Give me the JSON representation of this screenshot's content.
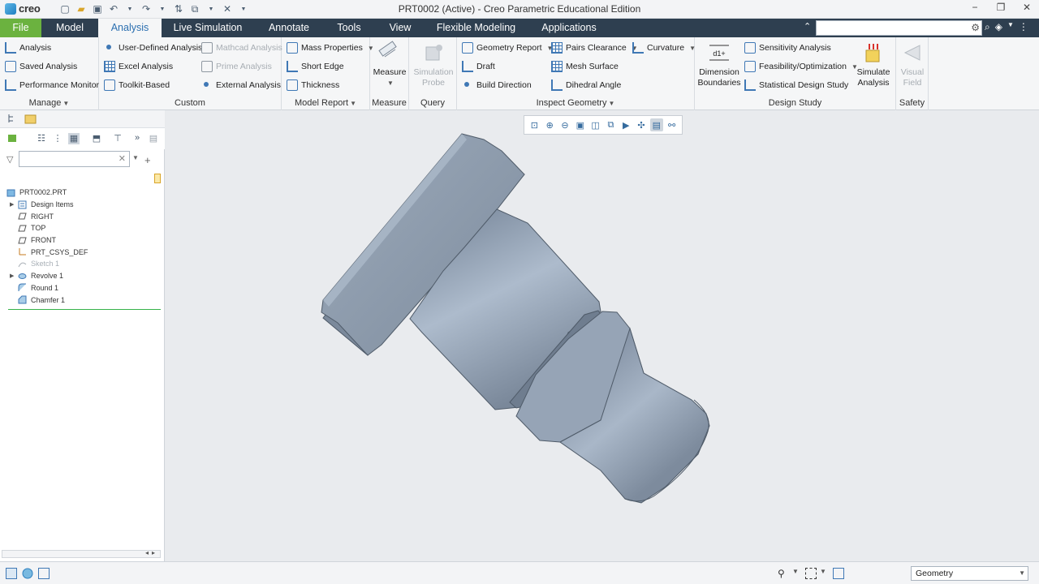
{
  "app": {
    "logo_text": "creo",
    "window_title": "PRT0002 (Active) - Creo Parametric Educational Edition"
  },
  "tabs": [
    {
      "label": "File"
    },
    {
      "label": "Model"
    },
    {
      "label": "Analysis"
    },
    {
      "label": "Live Simulation"
    },
    {
      "label": "Annotate"
    },
    {
      "label": "Tools"
    },
    {
      "label": "View"
    },
    {
      "label": "Flexible Modeling"
    },
    {
      "label": "Applications"
    }
  ],
  "search": {
    "placeholder": ""
  },
  "ribbon": {
    "manage": {
      "label": "Manage",
      "items": [
        "Analysis",
        "Saved Analysis",
        "Performance Monitor"
      ]
    },
    "custom": {
      "label": "Custom",
      "col1": [
        "User-Defined Analysis",
        "Excel Analysis",
        "Toolkit-Based"
      ],
      "col2": [
        "Mathcad Analysis",
        "Prime Analysis",
        "External Analysis"
      ]
    },
    "model_report": {
      "label": "Model Report",
      "items": [
        "Mass Properties",
        "Short Edge",
        "Thickness"
      ]
    },
    "measure": {
      "label": "Measure",
      "button": "Measure"
    },
    "query": {
      "label": "Query",
      "button_line1": "Simulation",
      "button_line2": "Probe"
    },
    "inspect": {
      "label": "Inspect Geometry",
      "col1": [
        "Geometry Report",
        "Draft",
        "Build Direction"
      ],
      "col2": [
        "Pairs Clearance",
        "Mesh Surface",
        "Dihedral Angle"
      ],
      "col3": [
        "Curvature"
      ]
    },
    "design_study": {
      "label": "Design Study",
      "dim_line1": "Dimension",
      "dim_line2": "Boundaries",
      "items": [
        "Sensitivity Analysis",
        "Feasibility/Optimization",
        "Statistical Design Study"
      ],
      "sim_line1": "Simulate",
      "sim_line2": "Analysis"
    },
    "safety": {
      "label": "Safety",
      "vf_line1": "Visual",
      "vf_line2": "Field"
    }
  },
  "model_tree": {
    "filter_value": "",
    "items": [
      {
        "label": "PRT0002.PRT",
        "dim": false
      },
      {
        "label": "Design Items",
        "dim": false
      },
      {
        "label": "RIGHT",
        "dim": false
      },
      {
        "label": "TOP",
        "dim": false
      },
      {
        "label": "FRONT",
        "dim": false
      },
      {
        "label": "PRT_CSYS_DEF",
        "dim": false
      },
      {
        "label": "Sketch 1",
        "dim": true
      },
      {
        "label": "Revolve 1",
        "dim": false
      },
      {
        "label": "Round 1",
        "dim": false
      },
      {
        "label": "Chamfer 1",
        "dim": false
      }
    ]
  },
  "statusbar": {
    "filter_value": "Geometry"
  },
  "colors": {
    "tabbar": "#2e3f50",
    "file_tab": "#6bb23f",
    "active_tab_text": "#2b6fb0",
    "part": "#8e9db0"
  }
}
